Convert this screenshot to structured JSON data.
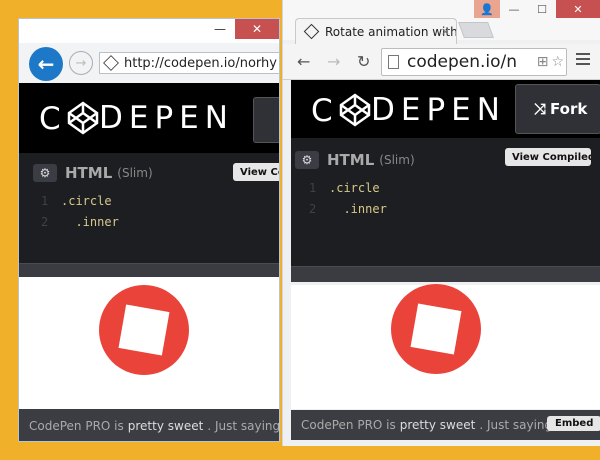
{
  "left_window": {
    "controls": {
      "minimize": "—",
      "close": "✕"
    },
    "nav": {
      "back": "←",
      "forward": "→"
    },
    "address": "http://codepen.io/norhy",
    "address_search": "⌕",
    "codepen": {
      "logo_text": "CODEPEN",
      "editor": {
        "gear": "⚙",
        "language": "HTML",
        "language_sub": "(Slim)",
        "view_button": "View Compiled",
        "lines": [
          {
            "num": "1",
            "text": ".circle"
          },
          {
            "num": "2",
            "text": "  .inner"
          }
        ]
      },
      "promo": {
        "prefix": "CodePen PRO is",
        "bold": "pretty sweet",
        "suffix": ". Just saying."
      }
    }
  },
  "right_window": {
    "tab": {
      "title": "Rotate animation with",
      "close": "×"
    },
    "controls": {
      "user": "👤",
      "minimize": "—",
      "maximize": "☐",
      "close": "✕"
    },
    "toolbar": {
      "back": "←",
      "forward": "→",
      "reload": "↻"
    },
    "address": "codepen.io/n",
    "address_icons": [
      "⊞",
      "☆"
    ],
    "codepen": {
      "logo_text": "CODEPEN",
      "fork_label": "Fork",
      "fork_icon": "⤨",
      "editor": {
        "gear": "⚙",
        "language": "HTML",
        "language_sub": "(Slim)",
        "view_button": "View Compiled",
        "lines": [
          {
            "num": "1",
            "text": ".circle"
          },
          {
            "num": "2",
            "text": "  .inner"
          }
        ]
      },
      "promo": {
        "prefix": "CodePen PRO is",
        "bold": "pretty sweet",
        "suffix": ". Just saying."
      },
      "embed_button": "Embed"
    }
  },
  "colors": {
    "desktop": "#f0b02a",
    "circle": "#e9433a",
    "ie_blue": "#1e78c8",
    "close_red": "#c75050"
  }
}
